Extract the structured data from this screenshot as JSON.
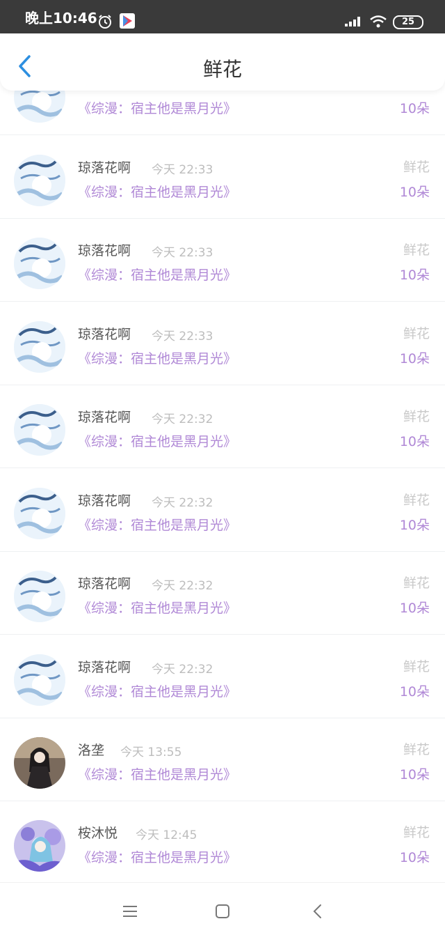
{
  "status_bar": {
    "time": "晚上10:46",
    "battery": "25"
  },
  "header": {
    "title": "鲜花"
  },
  "rows": [
    {
      "user": "",
      "time": "",
      "book": "《综漫：宿主他是黑月光》",
      "gift": "",
      "count": "10朵",
      "avatar": "blue"
    },
    {
      "user": "琼落花啊",
      "time": "今天 22:33",
      "book": "《综漫：宿主他是黑月光》",
      "gift": "鲜花",
      "count": "10朵",
      "avatar": "blue"
    },
    {
      "user": "琼落花啊",
      "time": "今天 22:33",
      "book": "《综漫：宿主他是黑月光》",
      "gift": "鲜花",
      "count": "10朵",
      "avatar": "blue"
    },
    {
      "user": "琼落花啊",
      "time": "今天 22:33",
      "book": "《综漫：宿主他是黑月光》",
      "gift": "鲜花",
      "count": "10朵",
      "avatar": "blue"
    },
    {
      "user": "琼落花啊",
      "time": "今天 22:32",
      "book": "《综漫：宿主他是黑月光》",
      "gift": "鲜花",
      "count": "10朵",
      "avatar": "blue"
    },
    {
      "user": "琼落花啊",
      "time": "今天 22:32",
      "book": "《综漫：宿主他是黑月光》",
      "gift": "鲜花",
      "count": "10朵",
      "avatar": "blue"
    },
    {
      "user": "琼落花啊",
      "time": "今天 22:32",
      "book": "《综漫：宿主他是黑月光》",
      "gift": "鲜花",
      "count": "10朵",
      "avatar": "blue"
    },
    {
      "user": "琼落花啊",
      "time": "今天 22:32",
      "book": "《综漫：宿主他是黑月光》",
      "gift": "鲜花",
      "count": "10朵",
      "avatar": "blue"
    },
    {
      "user": "洛垄",
      "time": "今天 13:55",
      "book": "《综漫：宿主他是黑月光》",
      "gift": "鲜花",
      "count": "10朵",
      "avatar": "dark"
    },
    {
      "user": "桉沐悦",
      "time": "今天 12:45",
      "book": "《综漫：宿主他是黑月光》",
      "gift": "鲜花",
      "count": "10朵",
      "avatar": "purple"
    }
  ]
}
